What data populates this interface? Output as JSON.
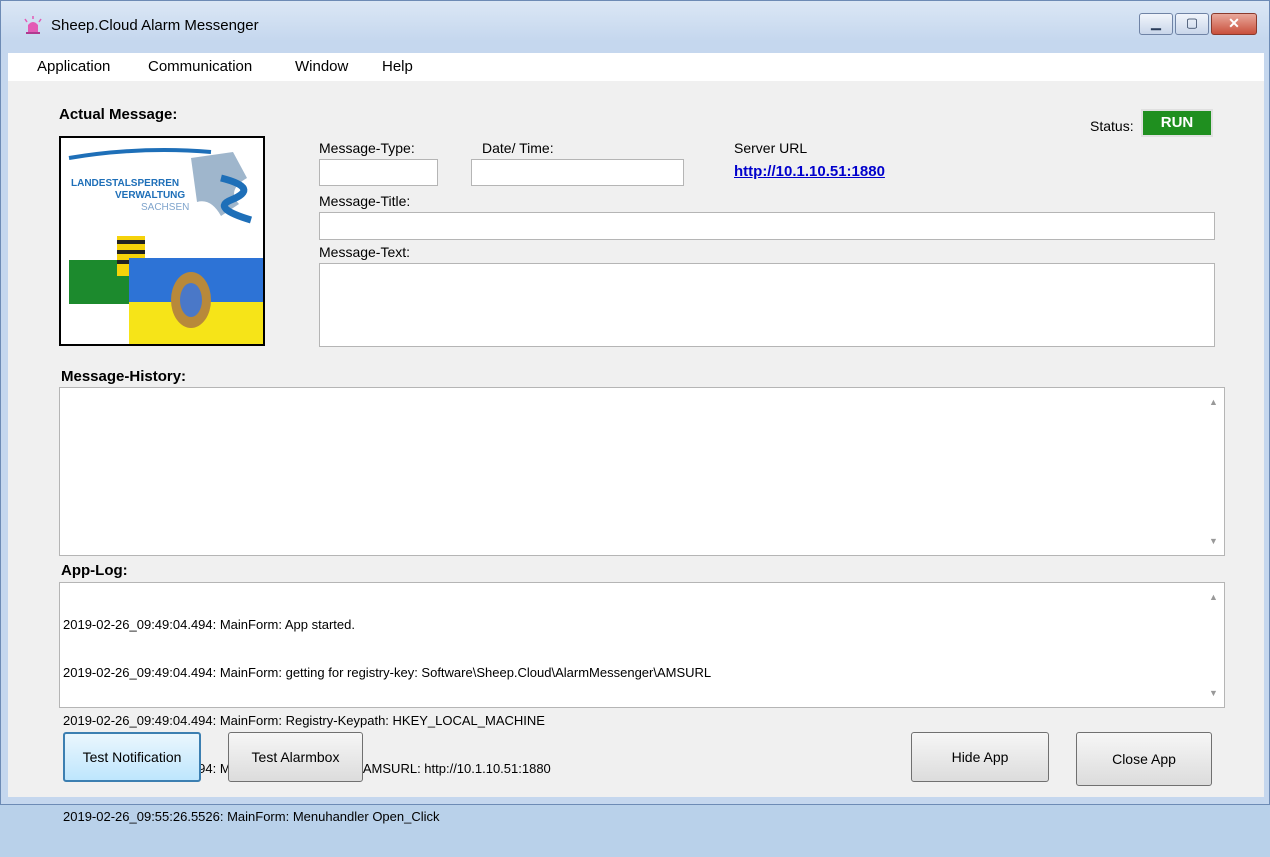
{
  "window": {
    "title": "Sheep.Cloud Alarm Messenger",
    "minimize": "▭",
    "maximize": "▣",
    "close": "✕"
  },
  "menu": [
    "Application",
    "Communication",
    "Window",
    "Help"
  ],
  "actual": {
    "heading": "Actual Message:",
    "type_label": "Message-Type:",
    "date_label": "Date/ Time:",
    "server_label": "Server URL",
    "server_url": "http://10.1.10.51:1880",
    "title_label": "Message-Title:",
    "text_label": "Message-Text:",
    "type_value": "",
    "date_value": "",
    "title_value": "",
    "text_value": ""
  },
  "status": {
    "label": "Status:",
    "value": "RUN",
    "color": "#1f8f1f"
  },
  "logo": {
    "line1": "LANDESTALSPERREN",
    "line2": "VERWALTUNG",
    "line3": "SACHSEN"
  },
  "history": {
    "heading": "Message-History:",
    "content": ""
  },
  "applog": {
    "heading": "App-Log:",
    "lines": [
      "2019-02-26_09:49:04.494: MainForm: App started.",
      "2019-02-26_09:49:04.494: MainForm: getting for registry-key: Software\\Sheep.Cloud\\AlarmMessenger\\AMSURL",
      "2019-02-26_09:49:04.494: MainForm: Registry-Keypath: HKEY_LOCAL_MACHINE",
      "2019-02-26_09:49:04.494: MainForm: Registry-Key AMSURL: http://10.1.10.51:1880",
      "2019-02-26_09:55:26.5526: MainForm: Menuhandler Open_Click"
    ]
  },
  "buttons": {
    "test_notification": "Test Notification",
    "test_alarmbox": "Test Alarmbox",
    "hide_app": "Hide App",
    "close_app": "Close App"
  },
  "icons": {
    "app": "siren-icon",
    "scroll_up": "▲",
    "scroll_down": "▼"
  }
}
